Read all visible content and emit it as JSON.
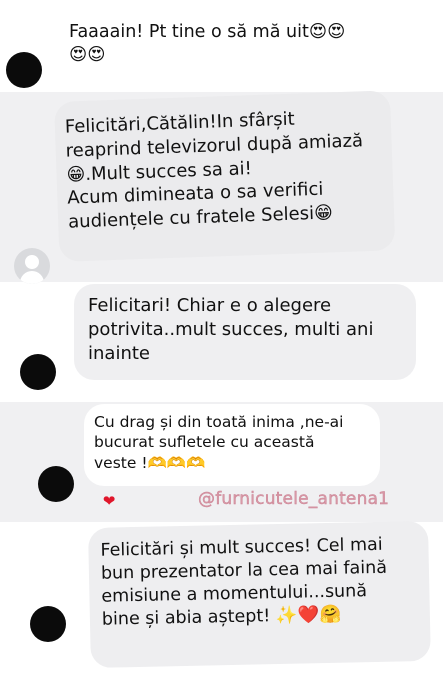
{
  "messages": [
    {
      "text": "Faaaain! Pt tine o să mă uit😍😍\n😍😍"
    },
    {
      "text": "Felicitări,Cătălin!In sfârșit\nreaprind televizorul după amiază\n😁.Mult succes sa ai!\nAcum dimineata o sa verifici\naudiențele cu fratele Selesi😁"
    },
    {
      "text": "Felicitari! Chiar e o alegere\npotrivita..mult succes, multi ani\ninainte"
    },
    {
      "text": "Cu drag și din toată inima ,ne-ai\nbucurat sufletele cu această\nveste !🫶🫶🫶"
    },
    {
      "text": "Felicitări și mult succes! Cel mai\nbun prezentator la cea mai faină\nemisiune a momentului...sună\nbine și abia aștept! ✨❤️🤗"
    }
  ],
  "reaction": "❤",
  "watermark": "@furnicutele_antena1",
  "colors": {
    "background": "#ececee",
    "bubble": "#eeeef0",
    "reaction": "#e0162b",
    "watermark": "#d99aa8"
  },
  "icons": {
    "default_avatar": "person-silhouette-icon"
  }
}
